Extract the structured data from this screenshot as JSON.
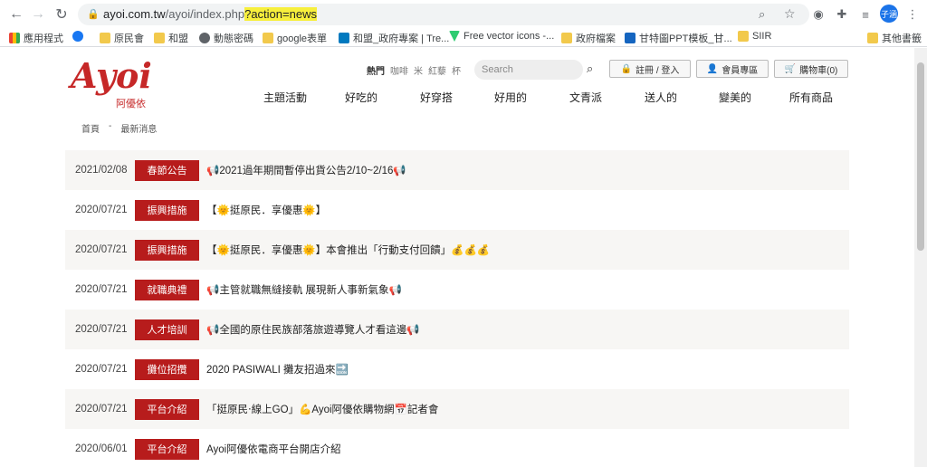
{
  "browser": {
    "url_host": "ayoi.com.tw",
    "url_path": "/ayoi/index.php",
    "url_query": "?action=news",
    "profile_label": "子涵",
    "bookmarks": [
      {
        "label": "應用程式",
        "icon": "apps-grid-icon"
      },
      {
        "label": "",
        "icon": "facebook-icon"
      },
      {
        "label": "原民會",
        "icon": "folder-icon"
      },
      {
        "label": "和盟",
        "icon": "folder-icon"
      },
      {
        "label": "動態密碼",
        "icon": "globe-icon"
      },
      {
        "label": "google表單",
        "icon": "folder-icon"
      },
      {
        "label": "和盟_政府專案 | Tre...",
        "icon": "trello-icon"
      },
      {
        "label": "Free vector icons -...",
        "icon": "vector-icon"
      },
      {
        "label": "政府檔案",
        "icon": "folder-icon"
      },
      {
        "label": "甘特圖PPT模板_甘...",
        "icon": "site-icon"
      },
      {
        "label": "SIIR",
        "icon": "folder-icon"
      },
      {
        "label": "其他書籤",
        "icon": "folder-icon"
      }
    ]
  },
  "site": {
    "logo_text": "Ayoi",
    "logo_sub": "阿優依",
    "hot_label": "熱門",
    "hot_keywords": [
      "咖啡",
      "米",
      "紅藜",
      "杯"
    ],
    "search_placeholder": "Search",
    "login_label": "註冊 / 登入",
    "member_label": "會員專區",
    "cart_label": "購物車(0)",
    "menu": [
      "主題活動",
      "好吃的",
      "好穿搭",
      "好用的",
      "文青派",
      "送人的",
      "變美的",
      "所有商品"
    ],
    "breadcrumb": [
      "首頁",
      "-",
      "最新消息"
    ]
  },
  "news": [
    {
      "date": "2021/02/08",
      "tag": "春節公告",
      "title": "📢2021過年期間暫停出貨公告2/10~2/16📢"
    },
    {
      "date": "2020/07/21",
      "tag": "振興措施",
      "title": "【🌞挺原民．享優惠🌞】"
    },
    {
      "date": "2020/07/21",
      "tag": "振興措施",
      "title": "【🌞挺原民．享優惠🌞】本會推出「行動支付回饋」💰💰💰"
    },
    {
      "date": "2020/07/21",
      "tag": "就職典禮",
      "title": "📢主管就職無縫接軌 展現新人事新氣象📢"
    },
    {
      "date": "2020/07/21",
      "tag": "人才培訓",
      "title": "📢全國的原住民族部落旅遊導覽人才看這邊📢"
    },
    {
      "date": "2020/07/21",
      "tag": "攤位招攬",
      "title": "2020 PASIWALI 攤友招過來🔜"
    },
    {
      "date": "2020/07/21",
      "tag": "平台介紹",
      "title": "「挺原民‧線上GO」💪Ayoi阿優依購物網📅記者會"
    },
    {
      "date": "2020/06/01",
      "tag": "平台介紹",
      "title": "Ayoi阿優依電商平台開店介紹"
    }
  ]
}
